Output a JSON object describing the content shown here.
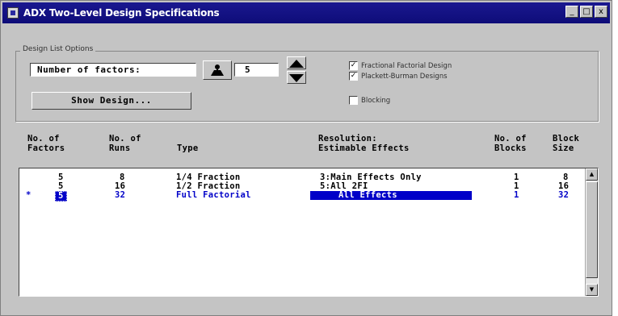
{
  "window": {
    "title": "ADX Two-Level Design Specifications",
    "buttons": [
      "minimize",
      "maximize",
      "close"
    ]
  },
  "options": {
    "group_label": "Design List Options",
    "factors_label": "Number of factors:",
    "factors_value": "5",
    "show_design_label": "Show Design...",
    "checkboxes": [
      {
        "label": "Fractional Factorial Design",
        "checked": true
      },
      {
        "label": "Plackett-Burman Designs",
        "checked": true
      },
      {
        "label": "Blocking",
        "checked": false
      }
    ]
  },
  "table": {
    "headers": [
      "No. of\nFactors",
      "No. of\nRuns",
      "Type",
      "Resolution:\nEstimable Effects",
      "No. of\nBlocks",
      "Block\nSize"
    ],
    "rows": [
      {
        "marker": "",
        "factors": "5",
        "runs": "8",
        "type": "1/4 Fraction",
        "resolution": "3:Main Effects Only",
        "blocks": "1",
        "block_size": "8"
      },
      {
        "marker": "",
        "factors": "5",
        "runs": "16",
        "type": "1/2 Fraction",
        "resolution": "5:All 2FI",
        "blocks": "1",
        "block_size": "16"
      },
      {
        "marker": "*",
        "factors": "5",
        "runs": "32",
        "type": "Full Factorial",
        "resolution": "All Effects",
        "blocks": "1",
        "block_size": "32"
      }
    ]
  },
  "colors": {
    "titlebar": "#1a1890",
    "selection": "#0000c8",
    "window_bg": "#c4c4c4"
  }
}
